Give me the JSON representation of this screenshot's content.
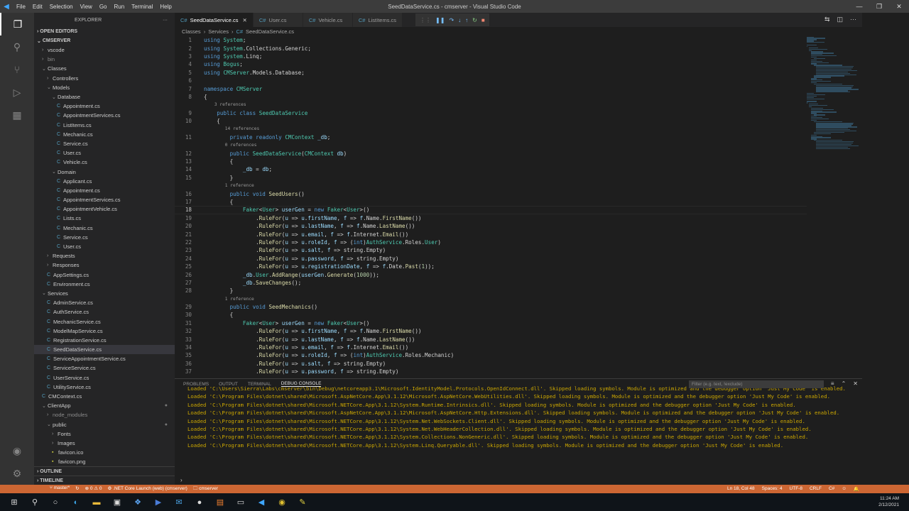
{
  "titlebar": {
    "menu": [
      "File",
      "Edit",
      "Selection",
      "View",
      "Go",
      "Run",
      "Terminal",
      "Help"
    ],
    "title": "SeedDataService.cs - cmserver - Visual Studio Code"
  },
  "sidebar": {
    "title": "EXPLORER",
    "open_editors": "OPEN EDITORS",
    "root": "CMSERVER",
    "items": [
      {
        "label": "vscode",
        "depth": 1,
        "kind": "folder",
        "open": false
      },
      {
        "label": "bin",
        "depth": 1,
        "kind": "folder",
        "open": false,
        "dim": true
      },
      {
        "label": "Classes",
        "depth": 1,
        "kind": "folder",
        "open": true
      },
      {
        "label": "Controllers",
        "depth": 2,
        "kind": "folder",
        "open": false
      },
      {
        "label": "Models",
        "depth": 2,
        "kind": "folder",
        "open": true
      },
      {
        "label": "Database",
        "depth": 3,
        "kind": "folder",
        "open": true
      },
      {
        "label": "Appointment.cs",
        "depth": 4,
        "kind": "file"
      },
      {
        "label": "AppointmentServices.cs",
        "depth": 4,
        "kind": "file"
      },
      {
        "label": "ListItems.cs",
        "depth": 4,
        "kind": "file"
      },
      {
        "label": "Mechanic.cs",
        "depth": 4,
        "kind": "file"
      },
      {
        "label": "Service.cs",
        "depth": 4,
        "kind": "file"
      },
      {
        "label": "User.cs",
        "depth": 4,
        "kind": "file"
      },
      {
        "label": "Vehicle.cs",
        "depth": 4,
        "kind": "file"
      },
      {
        "label": "Domain",
        "depth": 3,
        "kind": "folder",
        "open": true
      },
      {
        "label": "Applicant.cs",
        "depth": 4,
        "kind": "file"
      },
      {
        "label": "Appointment.cs",
        "depth": 4,
        "kind": "file"
      },
      {
        "label": "AppointmentServices.cs",
        "depth": 4,
        "kind": "file"
      },
      {
        "label": "AppointmentVehicle.cs",
        "depth": 4,
        "kind": "file"
      },
      {
        "label": "Lists.cs",
        "depth": 4,
        "kind": "file"
      },
      {
        "label": "Mechanic.cs",
        "depth": 4,
        "kind": "file"
      },
      {
        "label": "Service.cs",
        "depth": 4,
        "kind": "file"
      },
      {
        "label": "User.cs",
        "depth": 4,
        "kind": "file"
      },
      {
        "label": "Requests",
        "depth": 2,
        "kind": "folder",
        "open": false
      },
      {
        "label": "Responses",
        "depth": 2,
        "kind": "folder",
        "open": false
      },
      {
        "label": "AppSettings.cs",
        "depth": 2,
        "kind": "file"
      },
      {
        "label": "Environment.cs",
        "depth": 2,
        "kind": "file"
      },
      {
        "label": "Services",
        "depth": 1,
        "kind": "folder",
        "open": true
      },
      {
        "label": "AdminService.cs",
        "depth": 2,
        "kind": "file"
      },
      {
        "label": "AuthService.cs",
        "depth": 2,
        "kind": "file"
      },
      {
        "label": "MechanicService.cs",
        "depth": 2,
        "kind": "file"
      },
      {
        "label": "ModelMapService.cs",
        "depth": 2,
        "kind": "file"
      },
      {
        "label": "RegistrationService.cs",
        "depth": 2,
        "kind": "file"
      },
      {
        "label": "SeedDataService.cs",
        "depth": 2,
        "kind": "file",
        "selected": true
      },
      {
        "label": "ServiceAppointmentService.cs",
        "depth": 2,
        "kind": "file"
      },
      {
        "label": "ServiceService.cs",
        "depth": 2,
        "kind": "file"
      },
      {
        "label": "UserService.cs",
        "depth": 2,
        "kind": "file"
      },
      {
        "label": "UtilityService.cs",
        "depth": 2,
        "kind": "file"
      },
      {
        "label": "CMContext.cs",
        "depth": 1,
        "kind": "file"
      },
      {
        "label": "ClientApp",
        "depth": 1,
        "kind": "folder",
        "open": true,
        "dot": true
      },
      {
        "label": "node_modules",
        "depth": 2,
        "kind": "folder",
        "open": false,
        "dim": true
      },
      {
        "label": "public",
        "depth": 2,
        "kind": "folder",
        "open": true,
        "dot": true
      },
      {
        "label": "Fonts",
        "depth": 3,
        "kind": "folder",
        "open": false
      },
      {
        "label": "Images",
        "depth": 3,
        "kind": "folder",
        "open": false
      },
      {
        "label": "favicon.ico",
        "depth": 3,
        "kind": "file"
      },
      {
        "label": "favicon.png",
        "depth": 3,
        "kind": "file"
      }
    ],
    "outline": "OUTLINE",
    "timeline": "TIMELINE"
  },
  "tabs": [
    {
      "label": "SeedDataService.cs",
      "active": true
    },
    {
      "label": "User.cs",
      "active": false
    },
    {
      "label": "Vehicle.cs",
      "active": false
    },
    {
      "label": "ListItems.cs",
      "active": false
    }
  ],
  "breadcrumbs": [
    "Classes",
    "Services",
    "SeedDataService.cs"
  ],
  "code_lines": [
    {
      "n": "1",
      "t": "using System;"
    },
    {
      "n": "2",
      "t": "using System.Collections.Generic;"
    },
    {
      "n": "3",
      "t": "using System.Linq;"
    },
    {
      "n": "4",
      "t": "using Bogus;"
    },
    {
      "n": "5",
      "t": "using CMServer.Models.Database;"
    },
    {
      "n": "6",
      "t": ""
    },
    {
      "n": "7",
      "t": "namespace CMServer"
    },
    {
      "n": "8",
      "t": "{"
    },
    {
      "n": "",
      "t": "    3 references",
      "lens": true
    },
    {
      "n": "9",
      "t": "    public class SeedDataService"
    },
    {
      "n": "10",
      "t": "    {"
    },
    {
      "n": "",
      "t": "        14 references",
      "lens": true
    },
    {
      "n": "11",
      "t": "        private readonly CMContext _db;"
    },
    {
      "n": "",
      "t": "        0 references",
      "lens": true
    },
    {
      "n": "12",
      "t": "        public SeedDataService(CMContext db)"
    },
    {
      "n": "13",
      "t": "        {"
    },
    {
      "n": "14",
      "t": "            _db = db;"
    },
    {
      "n": "15",
      "t": "        }"
    },
    {
      "n": "",
      "t": "        1 reference",
      "lens": true
    },
    {
      "n": "16",
      "t": "        public void SeedUsers()"
    },
    {
      "n": "17",
      "t": "        {"
    },
    {
      "n": "18",
      "t": "            Faker<User> userGen = new Faker<User>()",
      "cur": true
    },
    {
      "n": "19",
      "t": "                .RuleFor(u => u.firstName, f => f.Name.FirstName())"
    },
    {
      "n": "20",
      "t": "                .RuleFor(u => u.lastName, f => f.Name.LastName())"
    },
    {
      "n": "21",
      "t": "                .RuleFor(u => u.email, f => f.Internet.Email())"
    },
    {
      "n": "22",
      "t": "                .RuleFor(u => u.roleId, f => (int)AuthService.Roles.User)"
    },
    {
      "n": "23",
      "t": "                .RuleFor(u => u.salt, f => string.Empty)"
    },
    {
      "n": "24",
      "t": "                .RuleFor(u => u.password, f => string.Empty)"
    },
    {
      "n": "25",
      "t": "                .RuleFor(u => u.registrationDate, f => f.Date.Past(1));"
    },
    {
      "n": "26",
      "t": "            _db.User.AddRange(userGen.Generate(1000));"
    },
    {
      "n": "27",
      "t": "            _db.SaveChanges();"
    },
    {
      "n": "28",
      "t": "        }"
    },
    {
      "n": "",
      "t": "        1 reference",
      "lens": true
    },
    {
      "n": "29",
      "t": "        public void SeedMechanics()"
    },
    {
      "n": "30",
      "t": "        {"
    },
    {
      "n": "31",
      "t": "            Faker<User> userGen = new Faker<User>()"
    },
    {
      "n": "32",
      "t": "                .RuleFor(u => u.firstName, f => f.Name.FirstName())"
    },
    {
      "n": "33",
      "t": "                .RuleFor(u => u.lastName, f => f.Name.LastName())"
    },
    {
      "n": "34",
      "t": "                .RuleFor(u => u.email, f => f.Internet.Email())"
    },
    {
      "n": "35",
      "t": "                .RuleFor(u => u.roleId, f => (int)AuthService.Roles.Mechanic)"
    },
    {
      "n": "36",
      "t": "                .RuleFor(u => u.salt, f => string.Empty)"
    },
    {
      "n": "37",
      "t": "                .RuleFor(u => u.password, f => string.Empty)"
    }
  ],
  "panel": {
    "tabs": [
      "PROBLEMS",
      "OUTPUT",
      "TERMINAL",
      "DEBUG CONSOLE"
    ],
    "active_tab": "DEBUG CONSOLE",
    "filter_placeholder": "Filter (e.g. text, !exclude)",
    "lines": [
      "Loaded 'C:\\Users\\Sierra\\Labs\\cmserver\\bin\\Debug\\netcoreapp3.1\\Microsoft.IdentityModel.Protocols.OpenIdConnect.dll'. Skipped loading symbols. Module is optimized and the debugger option 'Just My Code' is enabled.",
      "Loaded 'C:\\Program Files\\dotnet\\shared\\Microsoft.AspNetCore.App\\3.1.12\\Microsoft.AspNetCore.WebUtilities.dll'. Skipped loading symbols. Module is optimized and the debugger option 'Just My Code' is enabled.",
      "Loaded 'C:\\Program Files\\dotnet\\shared\\Microsoft.NETCore.App\\3.1.12\\System.Runtime.Intrinsics.dll'. Skipped loading symbols. Module is optimized and the debugger option 'Just My Code' is enabled.",
      "Loaded 'C:\\Program Files\\dotnet\\shared\\Microsoft.AspNetCore.App\\3.1.12\\Microsoft.AspNetCore.Http.Extensions.dll'. Skipped loading symbols. Module is optimized and the debugger option 'Just My Code' is enabled.",
      "Loaded 'C:\\Program Files\\dotnet\\shared\\Microsoft.NETCore.App\\3.1.12\\System.Net.WebSockets.Client.dll'. Skipped loading symbols. Module is optimized and the debugger option 'Just My Code' is enabled.",
      "Loaded 'C:\\Program Files\\dotnet\\shared\\Microsoft.NETCore.App\\3.1.12\\System.Net.WebHeaderCollection.dll'. Skipped loading symbols. Module is optimized and the debugger option 'Just My Code' is enabled.",
      "Loaded 'C:\\Program Files\\dotnet\\shared\\Microsoft.NETCore.App\\3.1.12\\System.Collections.NonGeneric.dll'. Skipped loading symbols. Module is optimized and the debugger option 'Just My Code' is enabled.",
      "Loaded 'C:\\Program Files\\dotnet\\shared\\Microsoft.NETCore.App\\3.1.12\\System.Linq.Queryable.dll'. Skipped loading symbols. Module is optimized and the debugger option 'Just My Code' is enabled."
    ]
  },
  "status": {
    "branch": "master*",
    "errors": "0",
    "warnings": "0",
    "launch": ".NET Core Launch (web) (cmserver)",
    "project": "cmserver",
    "position": "Ln 18, Col 48",
    "spaces": "Spaces: 4",
    "encoding": "UTF-8",
    "eol": "CRLF",
    "lang": "C#"
  },
  "taskbar": {
    "time": "11:24 AM",
    "date": "2/12/2021"
  },
  "colors": {
    "statusbar": "#cc6633",
    "accent": "#007acc"
  }
}
